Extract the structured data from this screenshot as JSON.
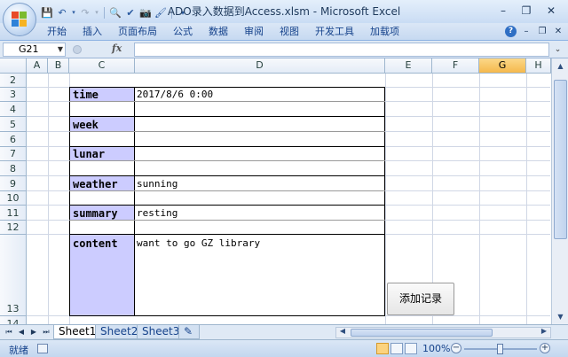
{
  "window": {
    "title": "ADO录入数据到Access.xlsm - Microsoft Excel",
    "minimize": "–",
    "restore": "❐",
    "close": "✕"
  },
  "ribbon": {
    "tabs": [
      "开始",
      "插入",
      "页面布局",
      "公式",
      "数据",
      "审阅",
      "视图",
      "开发工具",
      "加载项"
    ]
  },
  "formula_bar": {
    "name_box": "G21",
    "fx": "fx",
    "formula": ""
  },
  "grid": {
    "columns": [
      "A",
      "B",
      "C",
      "D",
      "E",
      "F",
      "G",
      "H"
    ],
    "selected_column": "G",
    "rows": [
      "2",
      "3",
      "4",
      "5",
      "6",
      "7",
      "8",
      "9",
      "10",
      "11",
      "12",
      "13",
      "14"
    ]
  },
  "form": {
    "fields": [
      {
        "label": "time",
        "value": "2017/8/6 0:00"
      },
      {
        "label": "week",
        "value": ""
      },
      {
        "label": "lunar",
        "value": ""
      },
      {
        "label": "weather",
        "value": "sunning"
      },
      {
        "label": "summary",
        "value": "resting"
      },
      {
        "label": "content",
        "value": "want to go GZ library"
      }
    ],
    "add_button": "添加记录"
  },
  "sheets": {
    "tabs": [
      "Sheet1",
      "Sheet2",
      "Sheet3"
    ],
    "active": "Sheet1"
  },
  "status": {
    "ready": "就绪",
    "zoom": "100%"
  },
  "icons": {
    "save": "save-icon",
    "undo": "undo-icon",
    "redo": "redo-icon"
  }
}
